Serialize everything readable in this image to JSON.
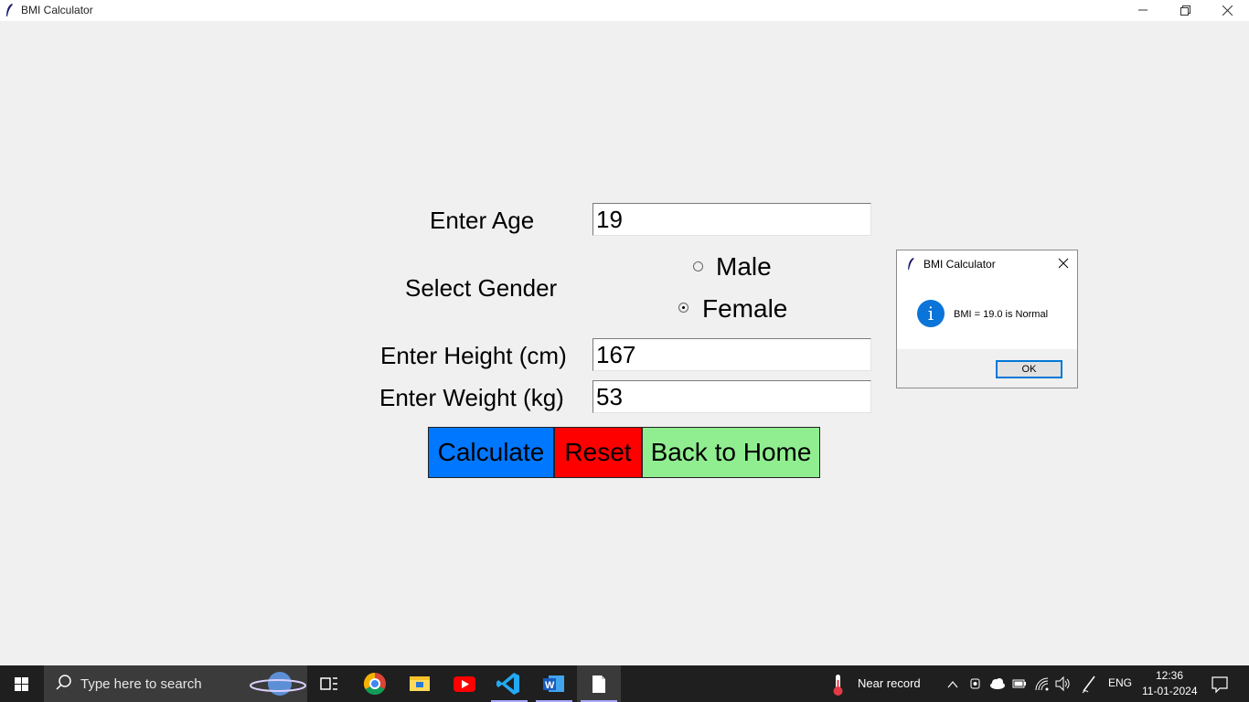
{
  "window": {
    "title": "BMI Calculator",
    "controls": [
      "minimize",
      "restore",
      "close"
    ]
  },
  "form": {
    "age_label": "Enter Age",
    "age_value": "19",
    "gender_label": "Select Gender",
    "gender_options": [
      {
        "label": "Male",
        "selected": false
      },
      {
        "label": "Female",
        "selected": true
      }
    ],
    "height_label": "Enter Height (cm)",
    "height_value": "167",
    "weight_label": "Enter Weight (kg)",
    "weight_value": "53"
  },
  "buttons": {
    "calculate": {
      "label": "Calculate",
      "color": "#0077ff"
    },
    "reset": {
      "label": "Reset",
      "color": "#ff0000"
    },
    "home": {
      "label": "Back to Home",
      "color": "#90ee90"
    }
  },
  "dialog": {
    "title": "BMI Calculator",
    "message": "BMI = 19.0 is Normal",
    "icon": "info-icon",
    "ok_label": "OK"
  },
  "taskbar": {
    "search_placeholder": "Type here to search",
    "apps": [
      "task-view",
      "chrome",
      "file-explorer",
      "youtube",
      "vs-code",
      "word",
      "notepad"
    ],
    "weather_text": "Near record",
    "language": "ENG",
    "time": "12:36",
    "date": "11-01-2024"
  }
}
